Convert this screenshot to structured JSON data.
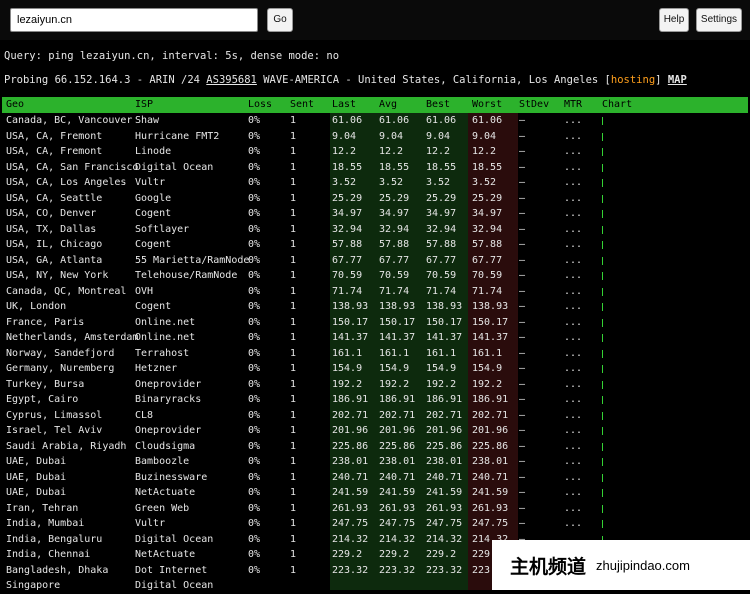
{
  "toolbar": {
    "host_value": "lezaiyun.cn",
    "go_label": "Go",
    "help_label": "Help",
    "settings_label": "Settings"
  },
  "query": {
    "text": "Query: ping lezaiyun.cn, interval: 5s, dense mode: no"
  },
  "probe": {
    "prefix": "Probing 66.152.164.3 - ARIN /24 ",
    "asn": "AS395681",
    "middle": " WAVE-AMERICA - United States, California, Los Angeles [",
    "hosting": "hosting",
    "suffix": "] ",
    "map": "MAP"
  },
  "table": {
    "headers": {
      "geo": "Geo",
      "isp": "ISP",
      "loss": "Loss",
      "sent": "Sent",
      "last": "Last",
      "avg": "Avg",
      "best": "Best",
      "worst": "Worst",
      "stdev": "StDev",
      "mtr": "MTR",
      "chart": "Chart"
    },
    "rows": [
      {
        "geo": "Canada, BC, Vancouver",
        "isp": "Shaw",
        "loss": "0%",
        "sent": "1",
        "last": "61.06",
        "avg": "61.06",
        "best": "61.06",
        "worst": "61.06",
        "stdev": "–",
        "mtr": "..."
      },
      {
        "geo": "USA, CA, Fremont",
        "isp": "Hurricane FMT2",
        "loss": "0%",
        "sent": "1",
        "last": "9.04",
        "avg": "9.04",
        "best": "9.04",
        "worst": "9.04",
        "stdev": "–",
        "mtr": "..."
      },
      {
        "geo": "USA, CA, Fremont",
        "isp": "Linode",
        "loss": "0%",
        "sent": "1",
        "last": "12.2",
        "avg": "12.2",
        "best": "12.2",
        "worst": "12.2",
        "stdev": "–",
        "mtr": "..."
      },
      {
        "geo": "USA, CA, San Francisco",
        "isp": "Digital Ocean",
        "loss": "0%",
        "sent": "1",
        "last": "18.55",
        "avg": "18.55",
        "best": "18.55",
        "worst": "18.55",
        "stdev": "–",
        "mtr": "..."
      },
      {
        "geo": "USA, CA, Los Angeles",
        "isp": "Vultr",
        "loss": "0%",
        "sent": "1",
        "last": "3.52",
        "avg": "3.52",
        "best": "3.52",
        "worst": "3.52",
        "stdev": "–",
        "mtr": "..."
      },
      {
        "geo": "USA, CA, Seattle",
        "isp": "Google",
        "loss": "0%",
        "sent": "1",
        "last": "25.29",
        "avg": "25.29",
        "best": "25.29",
        "worst": "25.29",
        "stdev": "–",
        "mtr": "..."
      },
      {
        "geo": "USA, CO, Denver",
        "isp": "Cogent",
        "loss": "0%",
        "sent": "1",
        "last": "34.97",
        "avg": "34.97",
        "best": "34.97",
        "worst": "34.97",
        "stdev": "–",
        "mtr": "..."
      },
      {
        "geo": "USA, TX, Dallas",
        "isp": "Softlayer",
        "loss": "0%",
        "sent": "1",
        "last": "32.94",
        "avg": "32.94",
        "best": "32.94",
        "worst": "32.94",
        "stdev": "–",
        "mtr": "..."
      },
      {
        "geo": "USA, IL, Chicago",
        "isp": "Cogent",
        "loss": "0%",
        "sent": "1",
        "last": "57.88",
        "avg": "57.88",
        "best": "57.88",
        "worst": "57.88",
        "stdev": "–",
        "mtr": "..."
      },
      {
        "geo": "USA, GA, Atlanta",
        "isp": "55 Marietta/RamNode",
        "loss": "0%",
        "sent": "1",
        "last": "67.77",
        "avg": "67.77",
        "best": "67.77",
        "worst": "67.77",
        "stdev": "–",
        "mtr": "..."
      },
      {
        "geo": "USA, NY, New York",
        "isp": "Telehouse/RamNode",
        "loss": "0%",
        "sent": "1",
        "last": "70.59",
        "avg": "70.59",
        "best": "70.59",
        "worst": "70.59",
        "stdev": "–",
        "mtr": "..."
      },
      {
        "geo": "Canada, QC, Montreal",
        "isp": "OVH",
        "loss": "0%",
        "sent": "1",
        "last": "71.74",
        "avg": "71.74",
        "best": "71.74",
        "worst": "71.74",
        "stdev": "–",
        "mtr": "..."
      },
      {
        "geo": "UK, London",
        "isp": "Cogent",
        "loss": "0%",
        "sent": "1",
        "last": "138.93",
        "avg": "138.93",
        "best": "138.93",
        "worst": "138.93",
        "stdev": "–",
        "mtr": "..."
      },
      {
        "geo": "France, Paris",
        "isp": "Online.net",
        "loss": "0%",
        "sent": "1",
        "last": "150.17",
        "avg": "150.17",
        "best": "150.17",
        "worst": "150.17",
        "stdev": "–",
        "mtr": "..."
      },
      {
        "geo": "Netherlands, Amsterdam",
        "isp": "Online.net",
        "loss": "0%",
        "sent": "1",
        "last": "141.37",
        "avg": "141.37",
        "best": "141.37",
        "worst": "141.37",
        "stdev": "–",
        "mtr": "..."
      },
      {
        "geo": "Norway, Sandefjord",
        "isp": "Terrahost",
        "loss": "0%",
        "sent": "1",
        "last": "161.1",
        "avg": "161.1",
        "best": "161.1",
        "worst": "161.1",
        "stdev": "–",
        "mtr": "..."
      },
      {
        "geo": "Germany, Nuremberg",
        "isp": "Hetzner",
        "loss": "0%",
        "sent": "1",
        "last": "154.9",
        "avg": "154.9",
        "best": "154.9",
        "worst": "154.9",
        "stdev": "–",
        "mtr": "..."
      },
      {
        "geo": "Turkey, Bursa",
        "isp": "Oneprovider",
        "loss": "0%",
        "sent": "1",
        "last": "192.2",
        "avg": "192.2",
        "best": "192.2",
        "worst": "192.2",
        "stdev": "–",
        "mtr": "..."
      },
      {
        "geo": "Egypt, Cairo",
        "isp": "Binaryracks",
        "loss": "0%",
        "sent": "1",
        "last": "186.91",
        "avg": "186.91",
        "best": "186.91",
        "worst": "186.91",
        "stdev": "–",
        "mtr": "..."
      },
      {
        "geo": "Cyprus, Limassol",
        "isp": "CL8",
        "loss": "0%",
        "sent": "1",
        "last": "202.71",
        "avg": "202.71",
        "best": "202.71",
        "worst": "202.71",
        "stdev": "–",
        "mtr": "..."
      },
      {
        "geo": "Israel, Tel Aviv",
        "isp": "Oneprovider",
        "loss": "0%",
        "sent": "1",
        "last": "201.96",
        "avg": "201.96",
        "best": "201.96",
        "worst": "201.96",
        "stdev": "–",
        "mtr": "..."
      },
      {
        "geo": "Saudi Arabia, Riyadh",
        "isp": "Cloudsigma",
        "loss": "0%",
        "sent": "1",
        "last": "225.86",
        "avg": "225.86",
        "best": "225.86",
        "worst": "225.86",
        "stdev": "–",
        "mtr": "..."
      },
      {
        "geo": "UAE, Dubai",
        "isp": "Bamboozle",
        "loss": "0%",
        "sent": "1",
        "last": "238.01",
        "avg": "238.01",
        "best": "238.01",
        "worst": "238.01",
        "stdev": "–",
        "mtr": "..."
      },
      {
        "geo": "UAE, Dubai",
        "isp": "Buzinessware",
        "loss": "0%",
        "sent": "1",
        "last": "240.71",
        "avg": "240.71",
        "best": "240.71",
        "worst": "240.71",
        "stdev": "–",
        "mtr": "..."
      },
      {
        "geo": "UAE, Dubai",
        "isp": "NetActuate",
        "loss": "0%",
        "sent": "1",
        "last": "241.59",
        "avg": "241.59",
        "best": "241.59",
        "worst": "241.59",
        "stdev": "–",
        "mtr": "..."
      },
      {
        "geo": "Iran, Tehran",
        "isp": "Green Web",
        "loss": "0%",
        "sent": "1",
        "last": "261.93",
        "avg": "261.93",
        "best": "261.93",
        "worst": "261.93",
        "stdev": "–",
        "mtr": "..."
      },
      {
        "geo": "India, Mumbai",
        "isp": "Vultr",
        "loss": "0%",
        "sent": "1",
        "last": "247.75",
        "avg": "247.75",
        "best": "247.75",
        "worst": "247.75",
        "stdev": "–",
        "mtr": "..."
      },
      {
        "geo": "India, Bengaluru",
        "isp": "Digital Ocean",
        "loss": "0%",
        "sent": "1",
        "last": "214.32",
        "avg": "214.32",
        "best": "214.32",
        "worst": "214.32",
        "stdev": "–",
        "mtr": "..."
      },
      {
        "geo": "India, Chennai",
        "isp": "NetActuate",
        "loss": "0%",
        "sent": "1",
        "last": "229.2",
        "avg": "229.2",
        "best": "229.2",
        "worst": "229",
        "stdev": "–",
        "mtr": "..."
      },
      {
        "geo": "Bangladesh, Dhaka",
        "isp": "Dot Internet",
        "loss": "0%",
        "sent": "1",
        "last": "223.32",
        "avg": "223.32",
        "best": "223.32",
        "worst": "223",
        "stdev": "–",
        "mtr": "..."
      },
      {
        "geo": "Singapore",
        "isp": "Digital Ocean",
        "loss": "",
        "sent": "",
        "last": "",
        "avg": "",
        "best": "",
        "worst": "",
        "stdev": "",
        "mtr": ""
      }
    ]
  },
  "watermark": {
    "cn": "主机频道",
    "en": "zhujipindao.com"
  },
  "colors": {
    "header_green": "#2cb22c",
    "hosting_orange": "#ff9f1c",
    "chart_tick": "#35d235"
  }
}
